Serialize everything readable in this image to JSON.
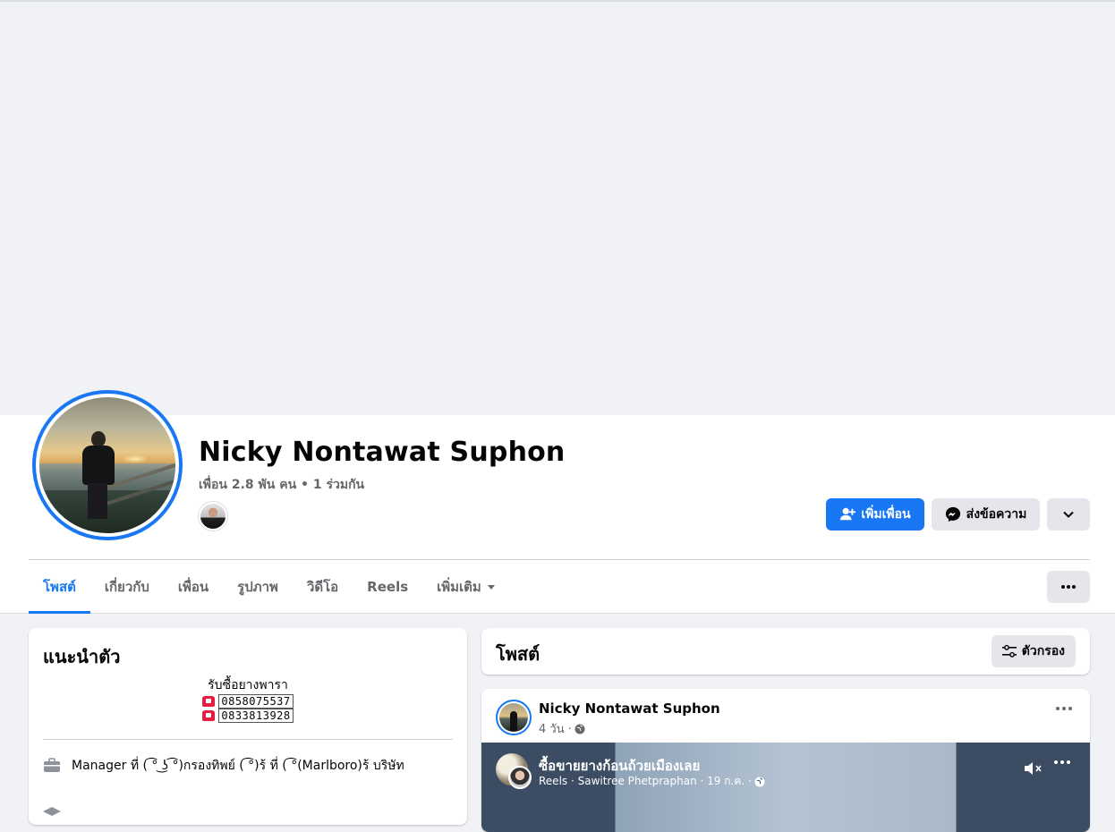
{
  "profile": {
    "name": "Nicky Nontawat Suphon",
    "friends_meta": "เพื่อน 2.8 พัน คน • 1 ร่วมกัน"
  },
  "actions": {
    "add_friend": "เพิ่มเพื่อน",
    "message": "ส่งข้อความ"
  },
  "tabs": [
    {
      "label": "โพสต์"
    },
    {
      "label": "เกี่ยวกับ"
    },
    {
      "label": "เพื่อน"
    },
    {
      "label": "รูปภาพ"
    },
    {
      "label": "วิดีโอ"
    },
    {
      "label": "Reels"
    },
    {
      "label": "เพิ่มเติม"
    }
  ],
  "intro": {
    "title": "แนะนำตัว",
    "bio_line": "รับซื้อยางพารา",
    "phones": [
      "0858075537",
      "0833813928"
    ],
    "work": "Manager ที่ ( ͡° ͜ʖ ͡°)กรองทิพย์ ( ͡°)ร้ ที่ ( ͡°(Marlboro)ร้ บริษัท"
  },
  "posts_section": {
    "title": "โพสต์",
    "filter_label": "ตัวกรอง"
  },
  "post": {
    "author": "Nicky Nontawat Suphon",
    "time": "4 วัน ·",
    "reel": {
      "title": "ซื้อขายยางก้อนถ้วยเมืองเลย",
      "meta": "Reels · Sawitree Phetpraphan · 19 ก.ค. ·"
    }
  },
  "colors": {
    "accent": "#1877f2",
    "secondary_button": "#e4e6eb",
    "page_bg": "#f0f2f5",
    "muted_text": "#65676b"
  }
}
